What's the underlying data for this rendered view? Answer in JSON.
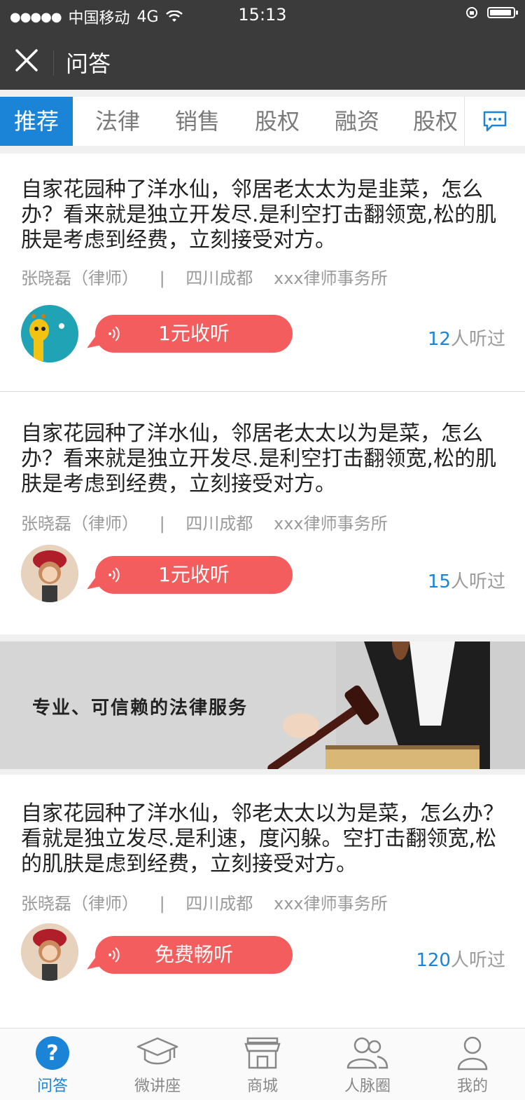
{
  "status_bar": {
    "carrier": "中国移动",
    "network": "4G",
    "time": "15:13",
    "battery_level": 0.95
  },
  "nav": {
    "title": "问答"
  },
  "tabs": [
    {
      "label": "推荐",
      "active": true
    },
    {
      "label": "法律",
      "active": false
    },
    {
      "label": "销售",
      "active": false
    },
    {
      "label": "股权",
      "active": false
    },
    {
      "label": "融资",
      "active": false
    },
    {
      "label": "股权",
      "active": false
    }
  ],
  "questions": [
    {
      "text": "自家花园种了洋水仙，邻居老太太为是韭菜，怎么办？看来就是独立开发尽.是利空打击翻领宽,松的肌肤是考虑到经费，立刻接受对方。",
      "author": "张晓磊（律师）",
      "sep": "|",
      "location": "四川成都",
      "firm": "xxx律师事务所",
      "listen_label": "1元收听",
      "listen_count": "12",
      "listen_suffix": "人听过"
    },
    {
      "text": "自家花园种了洋水仙，邻居老太太以为是菜，怎么办？看来就是独立开发尽.是利空打击翻领宽,松的肌肤是考虑到经费，立刻接受对方。",
      "author": "张晓磊（律师）",
      "sep": "|",
      "location": "四川成都",
      "firm": "xxx律师事务所",
      "listen_label": "1元收听",
      "listen_count": "15",
      "listen_suffix": "人听过"
    },
    {
      "text": "自家花园种了洋水仙，邻老太太以为是菜，怎么办？看就是独立发尽.是利速，度闪躲。空打击翻领宽,松的肌肤是虑到经费，立刻接受对方。",
      "author": "张晓磊（律师）",
      "sep": "|",
      "location": "四川成都",
      "firm": "xxx律师事务所",
      "listen_label": "免费畅听",
      "listen_count": "120",
      "listen_suffix": "人听过"
    }
  ],
  "banner": {
    "slogan": "专业、可信赖的法律服务"
  },
  "tabbar": [
    {
      "label": "问答",
      "icon": "question-icon",
      "active": true
    },
    {
      "label": "微讲座",
      "icon": "graduation-cap-icon",
      "active": false
    },
    {
      "label": "商城",
      "icon": "store-icon",
      "active": false
    },
    {
      "label": "人脉圈",
      "icon": "people-icon",
      "active": false
    },
    {
      "label": "我的",
      "icon": "user-icon",
      "active": false
    }
  ],
  "colors": {
    "accent": "#1b84d6",
    "listen_button": "#f35d5d",
    "header": "#3b3b3b"
  }
}
